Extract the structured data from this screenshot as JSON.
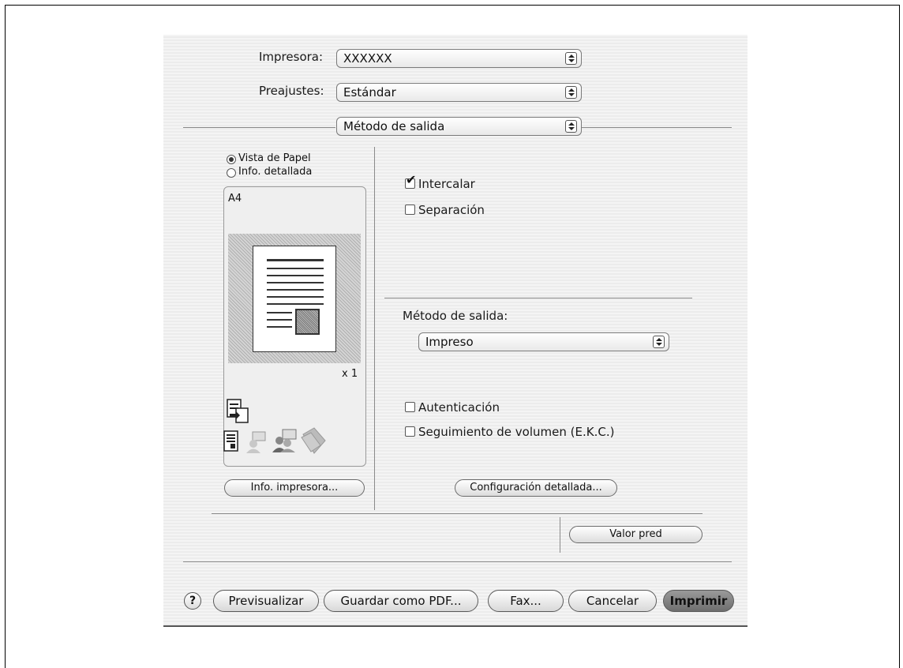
{
  "printer": {
    "label": "Impresora:",
    "value": "XXXXXX"
  },
  "presets": {
    "label": "Preajustes:",
    "value": "Estándar"
  },
  "panel_selector": {
    "value": "Método de salida"
  },
  "view": {
    "paper_view_label": "Vista de Papel",
    "detail_info_label": "Info. detallada",
    "selected": "paper_view"
  },
  "preview": {
    "paper_size": "A4",
    "copies": "x 1"
  },
  "options": {
    "collate": {
      "label": "Intercalar",
      "checked": true
    },
    "separation": {
      "label": "Separación",
      "checked": false
    }
  },
  "output_method": {
    "label": "Método de salida:",
    "value": "Impreso"
  },
  "auth": {
    "authentication": {
      "label": "Autenticación",
      "checked": false
    },
    "account_track": {
      "label": "Seguimiento de volumen (E.K.C.)",
      "checked": false
    }
  },
  "buttons": {
    "printer_info": "Info. impresora...",
    "detailed_settings": "Configuración detallada...",
    "default_value": "Valor pred",
    "help": "?",
    "preview": "Previsualizar",
    "save_pdf": "Guardar como PDF...",
    "fax": "Fax...",
    "cancel": "Cancelar",
    "print": "Imprimir"
  },
  "icons": [
    "printer-output-icon",
    "document-icon",
    "user-auth-icon",
    "account-track-icon",
    "stack-pages-icon"
  ]
}
